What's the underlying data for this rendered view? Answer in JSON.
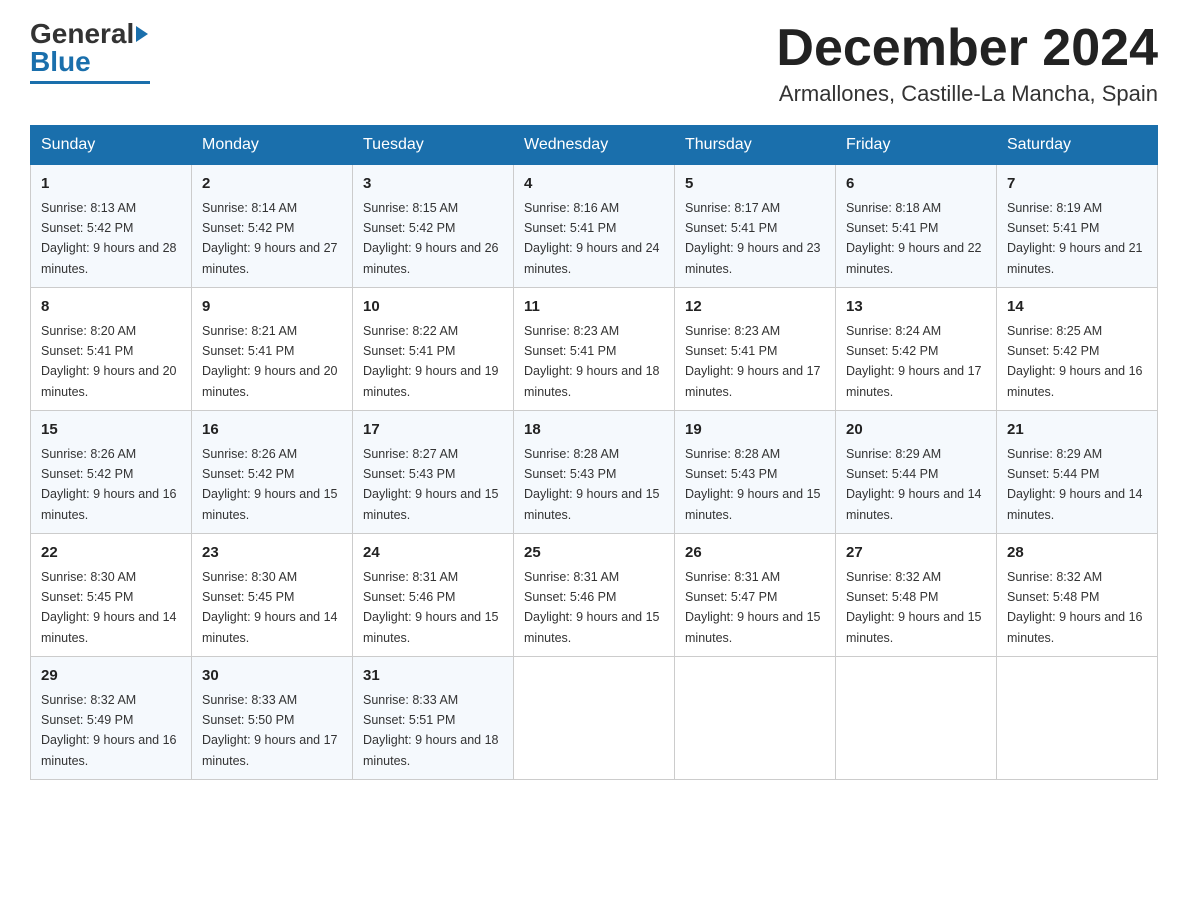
{
  "header": {
    "logo_general": "General",
    "logo_blue": "Blue",
    "month_title": "December 2024",
    "location": "Armallones, Castille-La Mancha, Spain"
  },
  "weekdays": [
    "Sunday",
    "Monday",
    "Tuesday",
    "Wednesday",
    "Thursday",
    "Friday",
    "Saturday"
  ],
  "weeks": [
    [
      {
        "day": "1",
        "sunrise": "8:13 AM",
        "sunset": "5:42 PM",
        "daylight": "9 hours and 28 minutes."
      },
      {
        "day": "2",
        "sunrise": "8:14 AM",
        "sunset": "5:42 PM",
        "daylight": "9 hours and 27 minutes."
      },
      {
        "day": "3",
        "sunrise": "8:15 AM",
        "sunset": "5:42 PM",
        "daylight": "9 hours and 26 minutes."
      },
      {
        "day": "4",
        "sunrise": "8:16 AM",
        "sunset": "5:41 PM",
        "daylight": "9 hours and 24 minutes."
      },
      {
        "day": "5",
        "sunrise": "8:17 AM",
        "sunset": "5:41 PM",
        "daylight": "9 hours and 23 minutes."
      },
      {
        "day": "6",
        "sunrise": "8:18 AM",
        "sunset": "5:41 PM",
        "daylight": "9 hours and 22 minutes."
      },
      {
        "day": "7",
        "sunrise": "8:19 AM",
        "sunset": "5:41 PM",
        "daylight": "9 hours and 21 minutes."
      }
    ],
    [
      {
        "day": "8",
        "sunrise": "8:20 AM",
        "sunset": "5:41 PM",
        "daylight": "9 hours and 20 minutes."
      },
      {
        "day": "9",
        "sunrise": "8:21 AM",
        "sunset": "5:41 PM",
        "daylight": "9 hours and 20 minutes."
      },
      {
        "day": "10",
        "sunrise": "8:22 AM",
        "sunset": "5:41 PM",
        "daylight": "9 hours and 19 minutes."
      },
      {
        "day": "11",
        "sunrise": "8:23 AM",
        "sunset": "5:41 PM",
        "daylight": "9 hours and 18 minutes."
      },
      {
        "day": "12",
        "sunrise": "8:23 AM",
        "sunset": "5:41 PM",
        "daylight": "9 hours and 17 minutes."
      },
      {
        "day": "13",
        "sunrise": "8:24 AM",
        "sunset": "5:42 PM",
        "daylight": "9 hours and 17 minutes."
      },
      {
        "day": "14",
        "sunrise": "8:25 AM",
        "sunset": "5:42 PM",
        "daylight": "9 hours and 16 minutes."
      }
    ],
    [
      {
        "day": "15",
        "sunrise": "8:26 AM",
        "sunset": "5:42 PM",
        "daylight": "9 hours and 16 minutes."
      },
      {
        "day": "16",
        "sunrise": "8:26 AM",
        "sunset": "5:42 PM",
        "daylight": "9 hours and 15 minutes."
      },
      {
        "day": "17",
        "sunrise": "8:27 AM",
        "sunset": "5:43 PM",
        "daylight": "9 hours and 15 minutes."
      },
      {
        "day": "18",
        "sunrise": "8:28 AM",
        "sunset": "5:43 PM",
        "daylight": "9 hours and 15 minutes."
      },
      {
        "day": "19",
        "sunrise": "8:28 AM",
        "sunset": "5:43 PM",
        "daylight": "9 hours and 15 minutes."
      },
      {
        "day": "20",
        "sunrise": "8:29 AM",
        "sunset": "5:44 PM",
        "daylight": "9 hours and 14 minutes."
      },
      {
        "day": "21",
        "sunrise": "8:29 AM",
        "sunset": "5:44 PM",
        "daylight": "9 hours and 14 minutes."
      }
    ],
    [
      {
        "day": "22",
        "sunrise": "8:30 AM",
        "sunset": "5:45 PM",
        "daylight": "9 hours and 14 minutes."
      },
      {
        "day": "23",
        "sunrise": "8:30 AM",
        "sunset": "5:45 PM",
        "daylight": "9 hours and 14 minutes."
      },
      {
        "day": "24",
        "sunrise": "8:31 AM",
        "sunset": "5:46 PM",
        "daylight": "9 hours and 15 minutes."
      },
      {
        "day": "25",
        "sunrise": "8:31 AM",
        "sunset": "5:46 PM",
        "daylight": "9 hours and 15 minutes."
      },
      {
        "day": "26",
        "sunrise": "8:31 AM",
        "sunset": "5:47 PM",
        "daylight": "9 hours and 15 minutes."
      },
      {
        "day": "27",
        "sunrise": "8:32 AM",
        "sunset": "5:48 PM",
        "daylight": "9 hours and 15 minutes."
      },
      {
        "day": "28",
        "sunrise": "8:32 AM",
        "sunset": "5:48 PM",
        "daylight": "9 hours and 16 minutes."
      }
    ],
    [
      {
        "day": "29",
        "sunrise": "8:32 AM",
        "sunset": "5:49 PM",
        "daylight": "9 hours and 16 minutes."
      },
      {
        "day": "30",
        "sunrise": "8:33 AM",
        "sunset": "5:50 PM",
        "daylight": "9 hours and 17 minutes."
      },
      {
        "day": "31",
        "sunrise": "8:33 AM",
        "sunset": "5:51 PM",
        "daylight": "9 hours and 18 minutes."
      },
      null,
      null,
      null,
      null
    ]
  ]
}
